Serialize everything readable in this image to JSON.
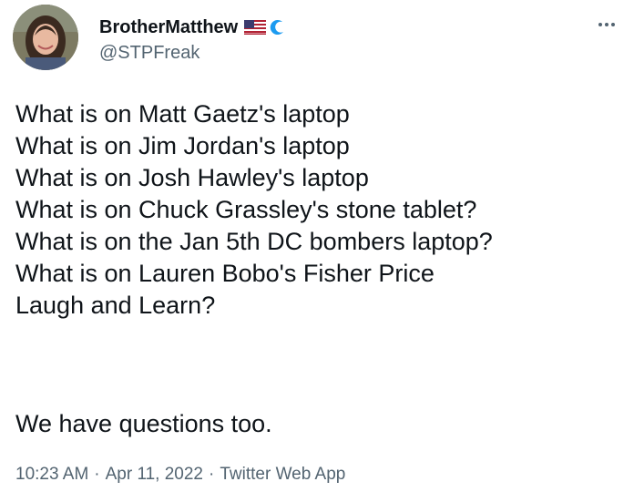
{
  "author": {
    "display_name": "BrotherMatthew",
    "handle": "@STPFreak",
    "badges": [
      "us-flag-icon",
      "blue-wave-icon"
    ]
  },
  "tweet": {
    "lines": [
      "What is on Matt Gaetz's laptop",
      "What is on Jim Jordan's laptop",
      "What is on Josh Hawley's laptop",
      "What is on Chuck Grassley's stone tablet?",
      "What is on the Jan 5th DC bombers laptop?",
      "What is on Lauren Bobo's Fisher Price",
      "Laugh and Learn?"
    ],
    "closing": "We have questions too."
  },
  "meta": {
    "time": "10:23 AM",
    "separator": "·",
    "date": "Apr 11, 2022",
    "source": "Twitter Web App"
  },
  "colors": {
    "text": "#0f1419",
    "secondary": "#536471",
    "wave": "#1d9bf0"
  },
  "icons": {
    "more": "more-options-icon"
  }
}
